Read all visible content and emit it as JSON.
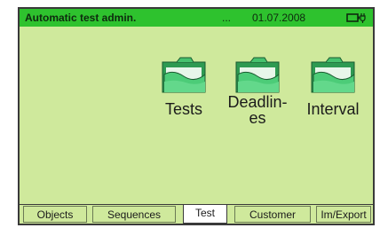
{
  "header": {
    "title": "Automatic test admin.",
    "dots": "...",
    "date": "01.07.2008",
    "battery_icon": "battery-charging-icon"
  },
  "items": [
    {
      "label": "Tests",
      "icon": "folder-icon"
    },
    {
      "label": "Deadlin-\nes",
      "icon": "folder-icon"
    },
    {
      "label": "Interval",
      "icon": "folder-icon"
    }
  ],
  "tabs": [
    {
      "label": "Objects"
    },
    {
      "label": "Sequences"
    },
    {
      "label": "Test",
      "active": true
    },
    {
      "label": "Customer"
    },
    {
      "label": "Im/Export"
    }
  ],
  "colors": {
    "titlebar": "#2ec22e",
    "background": "#cfe99c",
    "folder": "#3fbf6a"
  }
}
